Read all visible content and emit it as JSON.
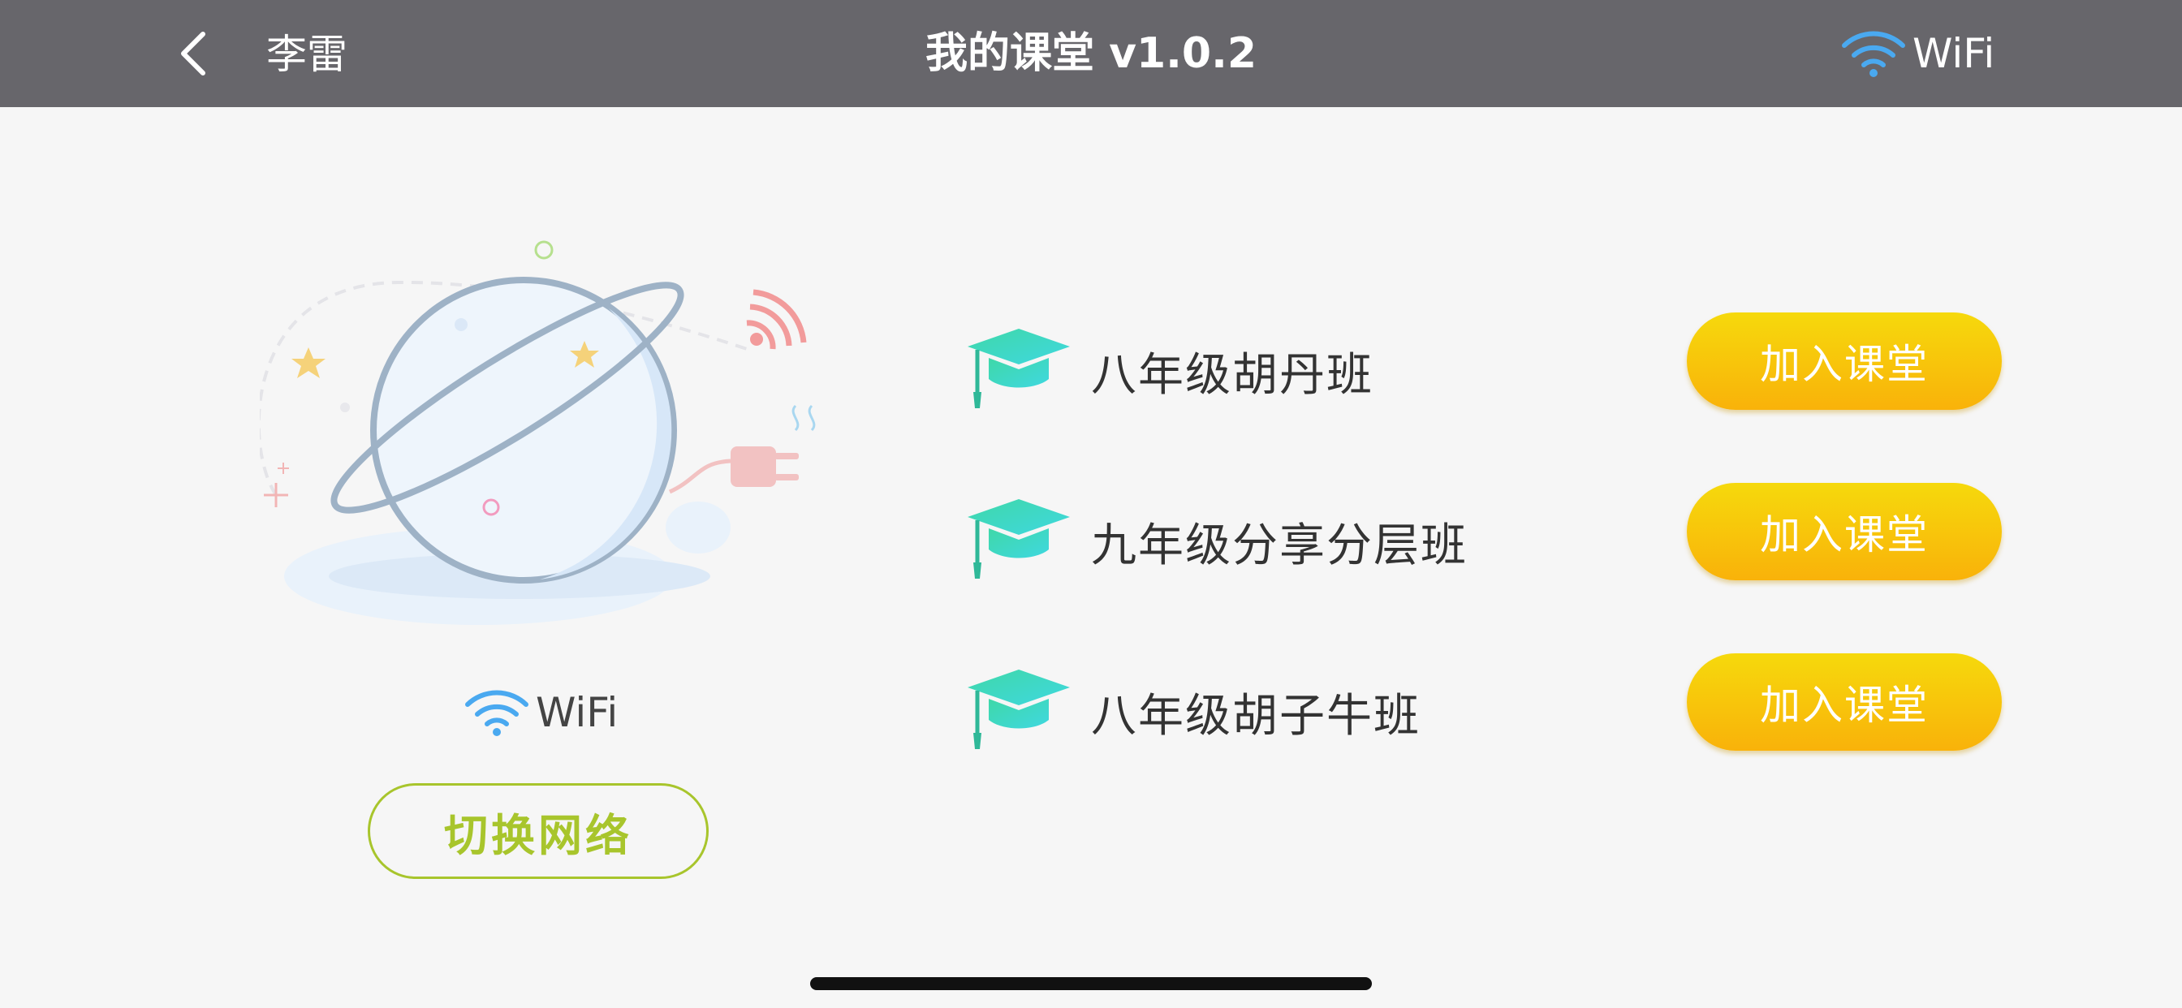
{
  "header": {
    "user_name": "李雷",
    "title": "我的课堂 v1.0.2",
    "wifi_label": "WiFi",
    "icons": {
      "back": "chevron-left-icon",
      "wifi": "wifi-icon"
    }
  },
  "network": {
    "status_label": "WiFi",
    "switch_button_label": "切换网络",
    "icons": {
      "wifi": "wifi-icon",
      "illustration": "planet-disconnected-illustration"
    }
  },
  "classes": [
    {
      "name": "八年级胡丹班",
      "join_label": "加入课堂"
    },
    {
      "name": "九年级分享分层班",
      "join_label": "加入课堂"
    },
    {
      "name": "八年级胡子牛班",
      "join_label": "加入课堂"
    }
  ],
  "colors": {
    "header_bg": "#67666b",
    "page_bg": "#f6f6f6",
    "accent_green": "#a8c52c",
    "join_gradient_top": "#f6d90c",
    "join_gradient_bottom": "#f9b20a",
    "wifi_blue": "#4aa9f0",
    "cap_teal": "#3fd8c8"
  }
}
